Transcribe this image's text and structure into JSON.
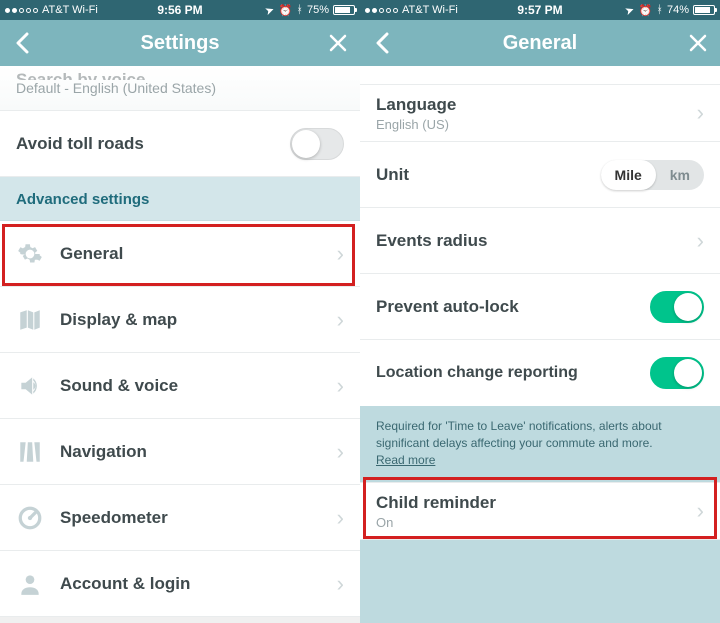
{
  "screen1": {
    "status": {
      "carrier": "AT&T Wi-Fi",
      "time": "9:56 PM",
      "battery": "75%",
      "signal_dots": 2
    },
    "nav": {
      "title": "Settings"
    },
    "partial": {
      "title": "Search by voice",
      "subtitle": "Default - English (United States)"
    },
    "toll_row": {
      "label": "Avoid toll roads",
      "on": false
    },
    "section": "Advanced settings",
    "items": [
      {
        "label": "General"
      },
      {
        "label": "Display & map"
      },
      {
        "label": "Sound & voice"
      },
      {
        "label": "Navigation"
      },
      {
        "label": "Speedometer"
      },
      {
        "label": "Account & login"
      }
    ]
  },
  "screen2": {
    "status": {
      "carrier": "AT&T Wi-Fi",
      "time": "9:57 PM",
      "battery": "74%",
      "signal_dots": 2
    },
    "nav": {
      "title": "General"
    },
    "language": {
      "label": "Language",
      "value": "English (US)"
    },
    "unit": {
      "label": "Unit",
      "options": [
        "Mile",
        "km"
      ],
      "selected": "Mile"
    },
    "events": {
      "label": "Events radius"
    },
    "autolock": {
      "label": "Prevent auto-lock",
      "on": true
    },
    "location": {
      "label": "Location change reporting",
      "on": true
    },
    "info": {
      "text": "Required for 'Time to Leave' notifications, alerts about significant delays affecting your commute and more.",
      "link": "Read more"
    },
    "child": {
      "label": "Child reminder",
      "value": "On"
    }
  },
  "icons": {
    "back": "‹",
    "close": "✕",
    "chevron": "›",
    "location_arrow": "➤",
    "alarm": "⏰",
    "bt": "ᚼ"
  }
}
